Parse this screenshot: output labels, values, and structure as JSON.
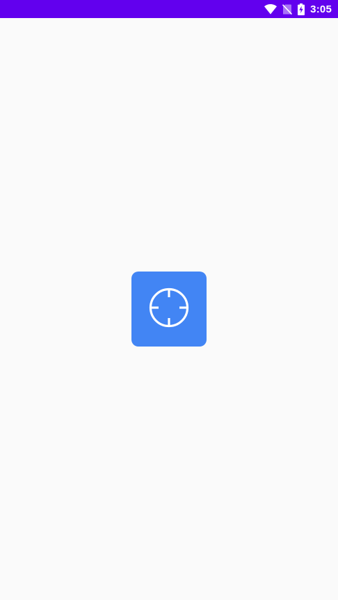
{
  "status_bar": {
    "background": "#6200ee",
    "time": "3:05",
    "icons": [
      "wifi-icon",
      "no-sim-icon",
      "battery-charging-icon"
    ]
  },
  "screen": {
    "background": "#fafafa"
  },
  "splash": {
    "icon": "crosshair-icon",
    "icon_background": "#4285f4",
    "icon_foreground": "#ffffff"
  }
}
